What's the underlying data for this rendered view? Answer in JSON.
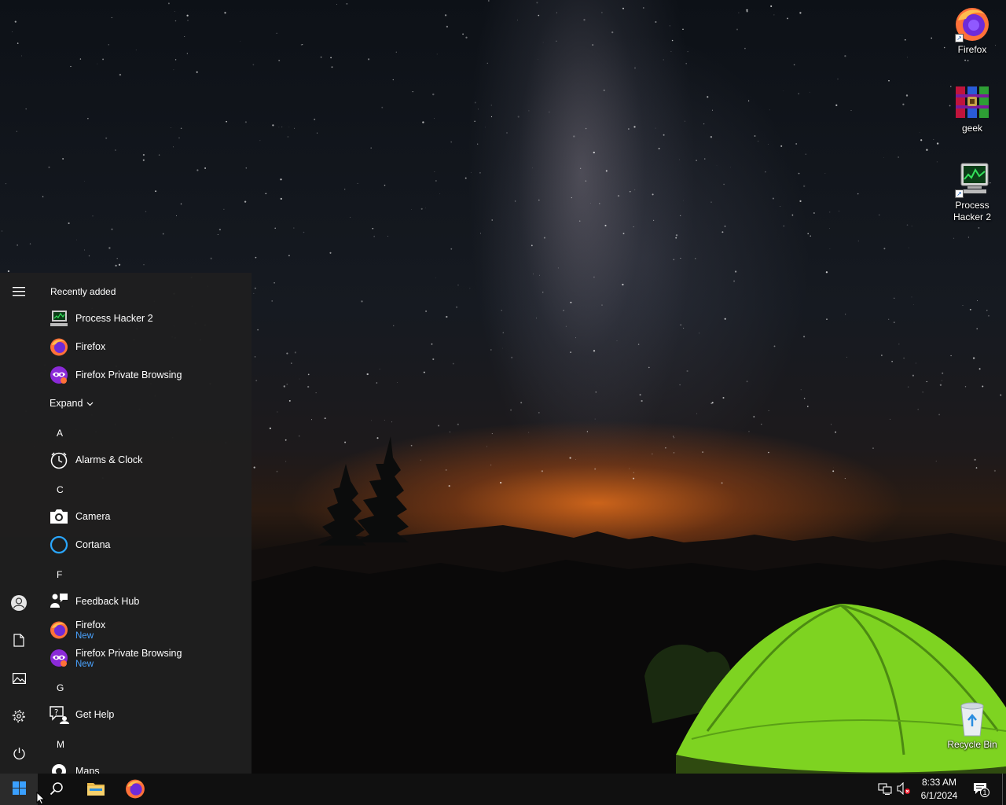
{
  "desktop": {
    "icons": [
      {
        "label": "Firefox",
        "icon": "firefox-icon"
      },
      {
        "label": "geek",
        "icon": "winrar-icon"
      },
      {
        "label": "Process Hacker 2",
        "icon": "process-hacker-icon"
      },
      {
        "label": "Recycle Bin",
        "icon": "recycle-bin-icon"
      }
    ]
  },
  "start_menu": {
    "rail": {
      "menu_icon": "hamburger-icon",
      "account_icon": "user-icon",
      "documents_icon": "document-icon",
      "pictures_icon": "pictures-icon",
      "settings_icon": "gear-icon",
      "power_icon": "power-icon"
    },
    "recently_added_title": "Recently added",
    "recently_added": [
      {
        "name": "Process Hacker 2"
      },
      {
        "name": "Firefox"
      },
      {
        "name": "Firefox Private Browsing"
      }
    ],
    "expand_label": "Expand",
    "groups": [
      {
        "letter": "A",
        "apps": [
          {
            "name": "Alarms & Clock"
          }
        ]
      },
      {
        "letter": "C",
        "apps": [
          {
            "name": "Camera"
          },
          {
            "name": "Cortana"
          }
        ]
      },
      {
        "letter": "F",
        "apps": [
          {
            "name": "Feedback Hub"
          },
          {
            "name": "Firefox",
            "badge": "New"
          },
          {
            "name": "Firefox Private Browsing",
            "badge": "New"
          }
        ]
      },
      {
        "letter": "G",
        "apps": [
          {
            "name": "Get Help"
          }
        ]
      },
      {
        "letter": "M",
        "apps": [
          {
            "name": "Maps"
          }
        ]
      }
    ]
  },
  "taskbar": {
    "start_icon": "windows-logo-icon",
    "search_icon": "search-icon",
    "pinned": [
      "file-explorer-icon",
      "firefox-icon"
    ],
    "tray": {
      "network_icon": "network-icon",
      "volume_icon": "volume-muted-icon",
      "time": "8:33 AM",
      "date": "6/1/2024",
      "notification_count": "1"
    }
  },
  "colors": {
    "menu_bg": "#1f1f1f",
    "taskbar_bg": "#101010",
    "new_badge": "#4aa3ff"
  }
}
